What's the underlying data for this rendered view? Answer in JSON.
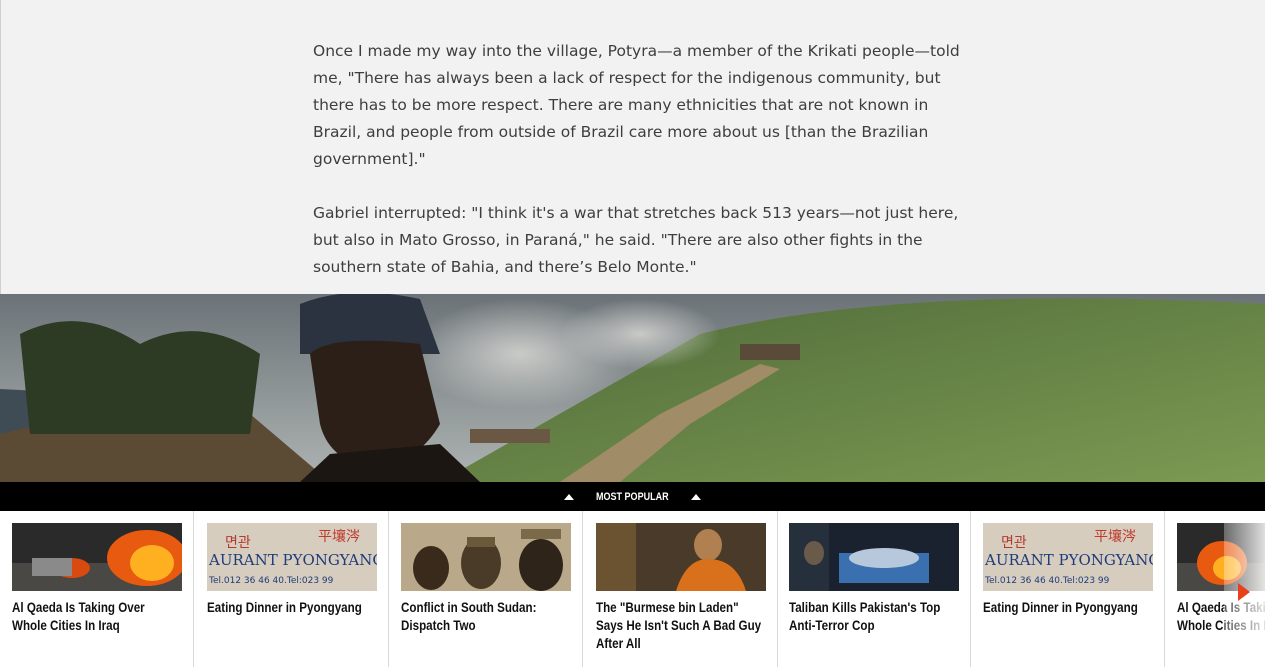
{
  "article": {
    "paragraphs": [
      "Once I made my way into the village, Potyra—a member of the Krikati people—told me, \"There has always been a lack of respect for the indigenous community, but there has to be more respect. There are many ethnicities that are not known in Brazil, and people from outside of Brazil care more about us [than the Brazilian government].\"",
      "Gabriel interrupted: \"I think it's a war that stretches back 513 years—not just here, but also in Mato Grosso, in Paraná,\" he said. \"There are also other fights in the southern state of Bahia, and there’s Belo Monte.\""
    ]
  },
  "most_popular": {
    "label": "MOST POPULAR",
    "items": [
      {
        "title": "Al Qaeda Is Taking Over Whole Cities In Iraq",
        "thumb": "fire-scene"
      },
      {
        "title": "Eating Dinner in Pyongyang",
        "thumb": "restaurant-sign"
      },
      {
        "title": "Conflict in South Sudan: Dispatch Two",
        "thumb": "soldiers"
      },
      {
        "title": "The \"Burmese bin Laden\" Says He Isn't Such A Bad Guy After All",
        "thumb": "monk"
      },
      {
        "title": "Taliban Kills Pakistan's Top Anti-Terror Cop",
        "thumb": "hospital"
      },
      {
        "title": "Eating Dinner in Pyongyang",
        "thumb": "restaurant-sign"
      },
      {
        "title": "Al Qaeda Is Taking Over Whole Cities In Iraq",
        "thumb": "fire-scene"
      }
    ]
  },
  "sign": {
    "hanzi": "平壤涔",
    "hangul": "면관",
    "latin": "AURANT PYONGYANG",
    "phone": "Tel.012 36 46 40.Tel:023 99"
  },
  "icons": {
    "collapse": "triangle-up-icon",
    "next": "arrow-right-icon"
  },
  "colors": {
    "bar": "#000000",
    "next_arrow": "#e8401c"
  }
}
